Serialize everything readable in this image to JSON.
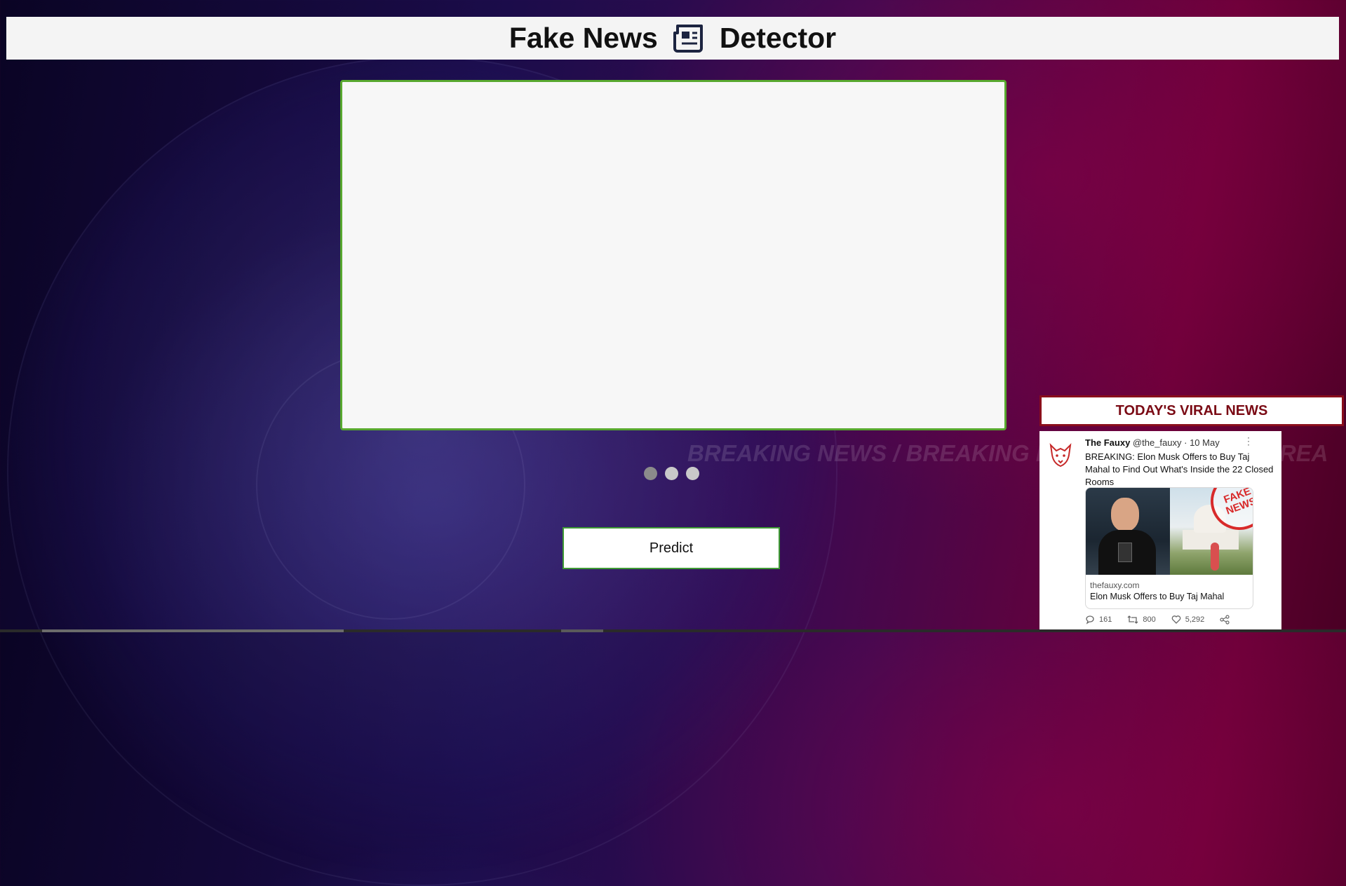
{
  "header": {
    "title_left": "Fake News",
    "title_right": "Detector",
    "title_icon": "newspaper-icon"
  },
  "main": {
    "news_input": {
      "value": "",
      "placeholder": ""
    },
    "carousel": {
      "dot_count": 3,
      "active_index": 0
    },
    "predict_label": "Predict"
  },
  "background": {
    "banner_text": "BREAKING NEWS / BREAKING NEWS",
    "banner_text_2": "BREA"
  },
  "viral": {
    "heading": "TODAY'S VIRAL NEWS",
    "tweet": {
      "author": "The Fauxy",
      "handle": "@the_fauxy",
      "date": "· 10 May",
      "more": "⋮",
      "text": "BREAKING: Elon Musk Offers to Buy Taj Mahal to Find Out What's Inside the 22 Closed Rooms",
      "stamp_line1": "FAKE",
      "stamp_line2": "NEWS",
      "link_domain": "thefauxy.com",
      "link_title": "Elon Musk Offers to Buy Taj Mahal",
      "replies": "161",
      "retweets": "800",
      "likes": "5,292"
    }
  },
  "colors": {
    "panel_border": "#58a82f",
    "button_border": "#3f9a35",
    "viral_accent": "#8a0e1c",
    "stamp": "#d82a2a"
  }
}
